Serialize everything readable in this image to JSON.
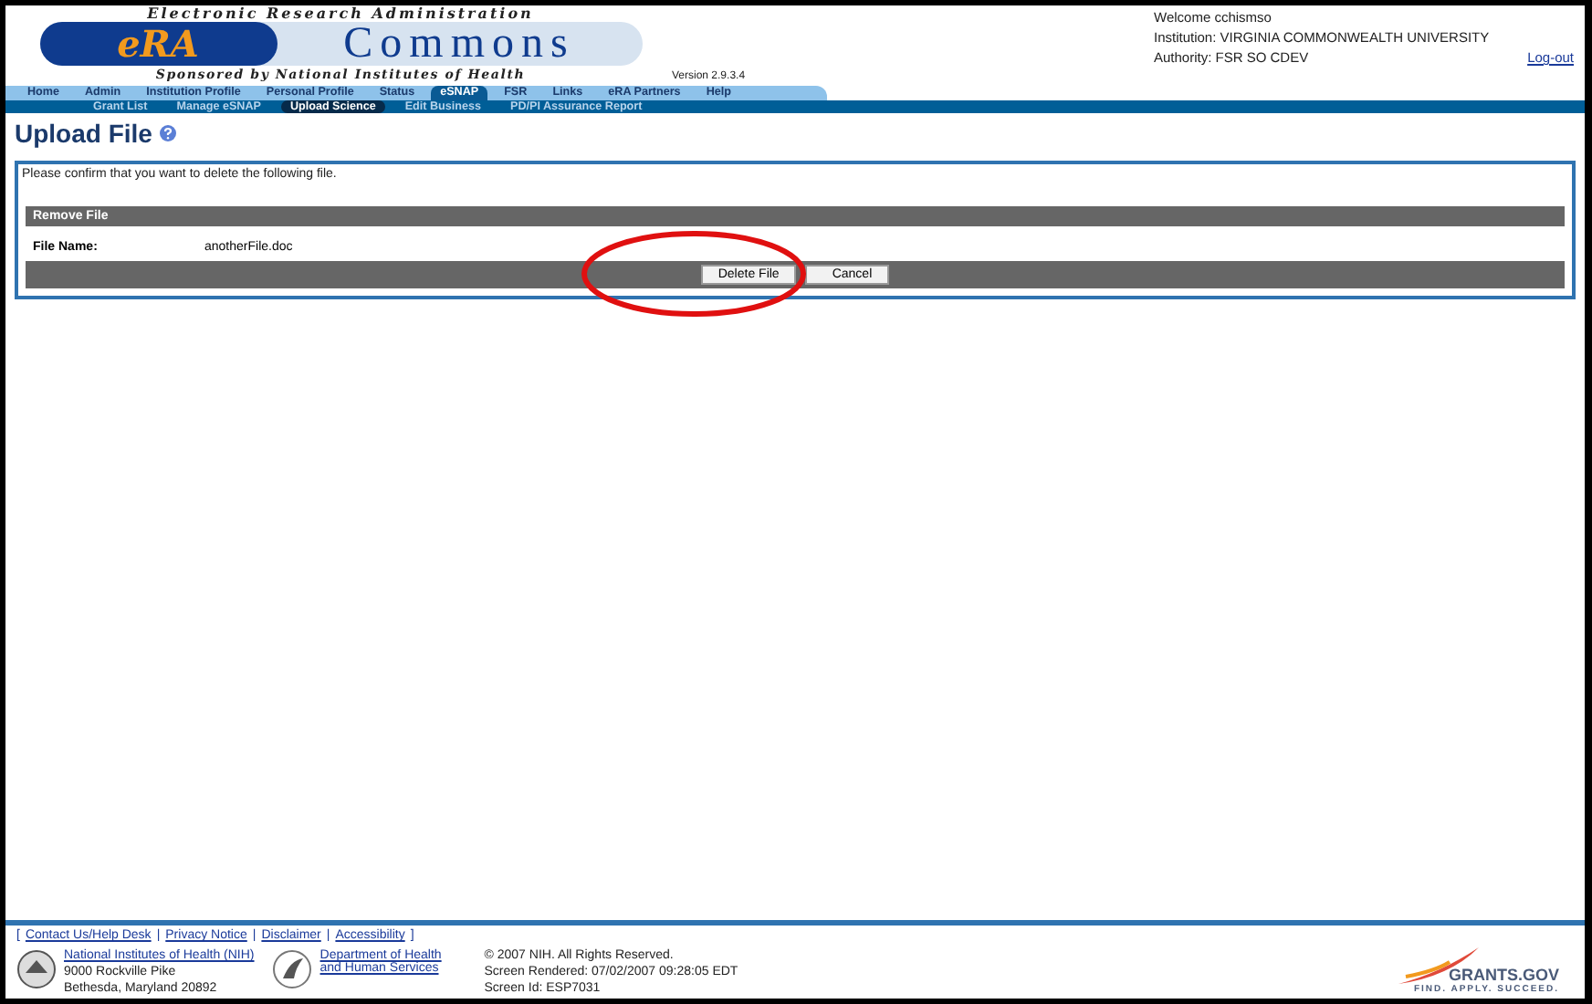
{
  "logo": {
    "top": "Electronic Research Administration",
    "era": "eRA",
    "commons": "Commons",
    "sponsor": "Sponsored by National Institutes of Health",
    "version": "Version 2.9.3.4"
  },
  "user": {
    "welcome": "Welcome  cchismso",
    "institution": "Institution: VIRGINIA COMMONWEALTH UNIVERSITY",
    "authority": "Authority:  FSR  SO  CDEV",
    "logout": "Log-out"
  },
  "nav": [
    {
      "label": "Home",
      "selected": false
    },
    {
      "label": "Admin",
      "selected": false
    },
    {
      "label": "Institution Profile",
      "selected": false
    },
    {
      "label": "Personal Profile",
      "selected": false
    },
    {
      "label": "Status",
      "selected": false
    },
    {
      "label": "eSNAP",
      "selected": true
    },
    {
      "label": "FSR",
      "selected": false
    },
    {
      "label": "Links",
      "selected": false
    },
    {
      "label": "eRA Partners",
      "selected": false
    },
    {
      "label": "Help",
      "selected": false
    }
  ],
  "subnav": [
    {
      "label": "Grant List",
      "selected": false
    },
    {
      "label": "Manage eSNAP",
      "selected": false
    },
    {
      "label": "Upload Science",
      "selected": true
    },
    {
      "label": "Edit Business",
      "selected": false
    },
    {
      "label": "PD/PI Assurance Report",
      "selected": false
    }
  ],
  "page_title": "Upload File",
  "confirm_text": "Please confirm that you want to delete the following file.",
  "section_title": "Remove File",
  "field": {
    "label": "File Name:",
    "value": "anotherFile.doc"
  },
  "buttons": [
    "Delete File",
    "Cancel"
  ],
  "footer": {
    "open_bracket": "[",
    "separators": [
      "|",
      "|",
      "|"
    ],
    "close_bracket": "]",
    "links": [
      "Contact Us/Help Desk",
      "Privacy Notice",
      "Disclaimer",
      "Accessibility"
    ],
    "nih": {
      "link": "National Institutes of Health (NIH)",
      "lines": [
        "9000 Rockville Pike",
        "Bethesda, Maryland 20892"
      ]
    },
    "hhs": {
      "link": "Department of Health and Human Services"
    },
    "info": [
      "© 2007 NIH. All Rights Reserved.",
      "Screen Rendered: 07/02/2007 09:28:05 EDT",
      "Screen Id: ESP7031"
    ],
    "grants": {
      "name": "GRANTS.GOV",
      "tagline": "FIND. APPLY. SUCCEED."
    }
  }
}
